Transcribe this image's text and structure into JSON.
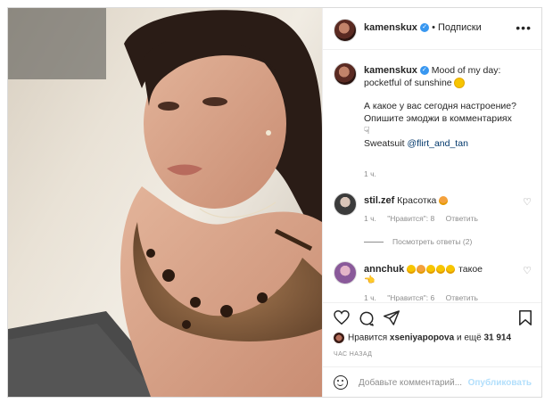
{
  "post": {
    "username": "kamenskux",
    "follow_label": "Подписки",
    "more_label": "•••"
  },
  "caption": {
    "username": "kamenskux",
    "line1": "Mood of my day:",
    "line2": "pocketful of sunshine",
    "line3": "А какое у вас сегодня настроение?",
    "line4": "Опишите эмоджи в комментариях",
    "line5_prefix": "Sweatsuit ",
    "line5_link": "@flirt_and_tan",
    "time": "1 ч."
  },
  "comments": [
    {
      "username": "stil.zef",
      "text": "Красотка",
      "time": "1 ч.",
      "likes": "\"Нравится\": 8",
      "reply": "Ответить",
      "replies": "Посмотреть ответы (2)"
    },
    {
      "username": "annchuk",
      "text": "такое",
      "time": "1 ч.",
      "likes": "\"Нравится\": 6",
      "reply": "Ответить"
    }
  ],
  "likes": {
    "prefix": "Нравится ",
    "user": "xseniyapopova",
    "middle": " и ещё ",
    "count": "31 914"
  },
  "ago": "ЧАС НАЗАД",
  "add_comment": {
    "placeholder": "Добавьте комментарий...",
    "publish": "Опубликовать"
  },
  "colors": {
    "verified": "#3897f0",
    "link": "#00376b",
    "muted": "#8e8e8e",
    "publish_disabled": "#b2dffc"
  },
  "icons": [
    "heart-icon",
    "comment-icon",
    "share-icon",
    "bookmark-icon",
    "emoji-icon",
    "verified-icon",
    "more-icon"
  ]
}
